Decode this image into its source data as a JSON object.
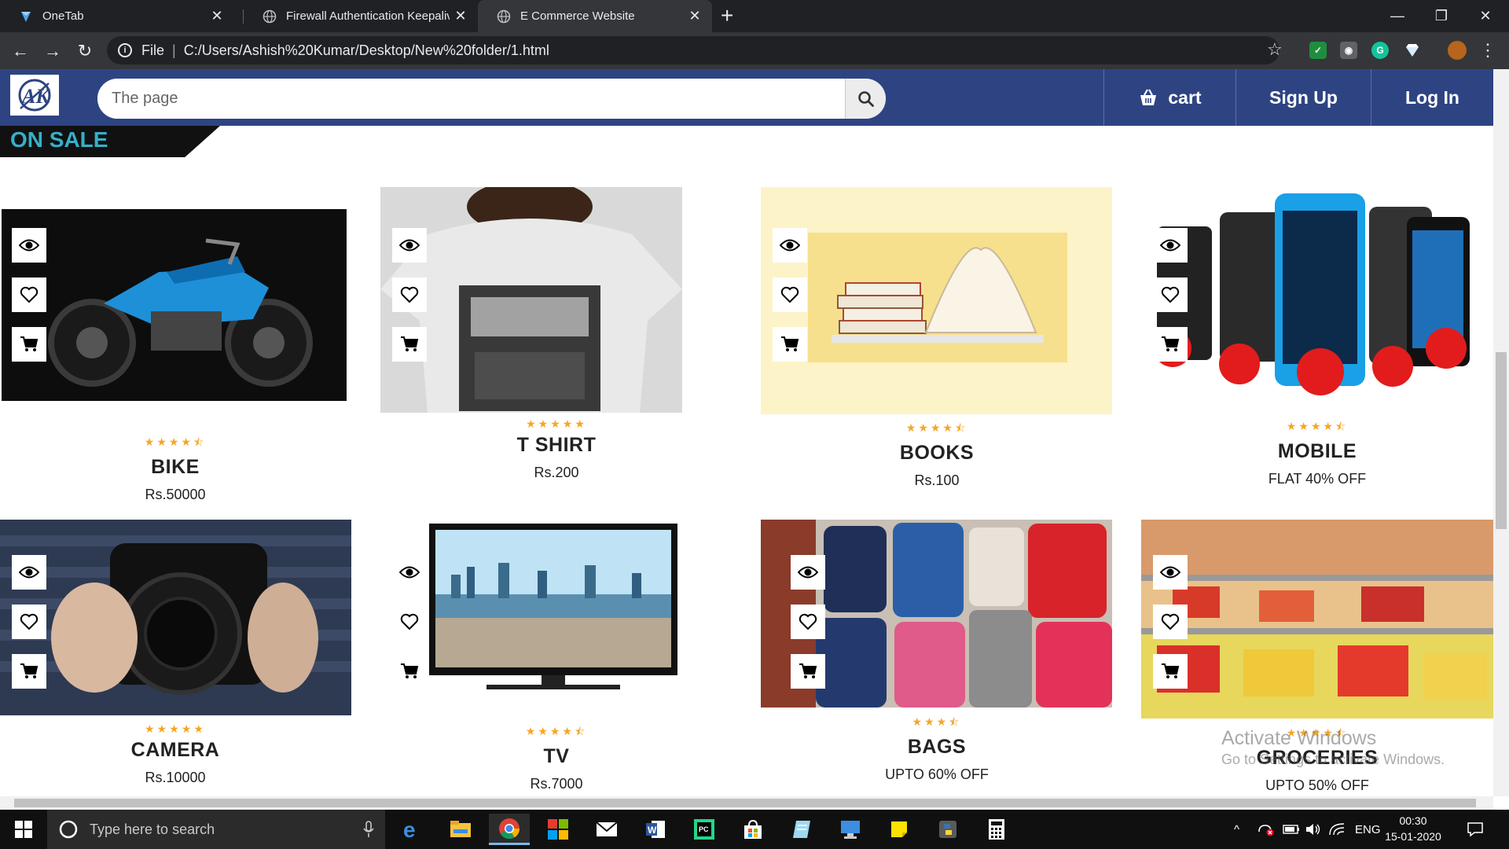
{
  "browser": {
    "tabs": [
      {
        "title": "OneTab",
        "icon": "onetab-icon",
        "active": false
      },
      {
        "title": "Firewall Authentication Keepalive",
        "icon": "globe-icon",
        "active": false
      },
      {
        "title": "E Commerce Website",
        "icon": "globe-icon",
        "active": true
      }
    ],
    "address": {
      "scheme_label": "File",
      "url": "C:/Users/Ashish%20Kumar/Desktop/New%20folder/1.html"
    }
  },
  "header": {
    "logo_text": "AK",
    "search_placeholder": "The page",
    "cart_label": "cart",
    "signup_label": "Sign Up",
    "login_label": "Log In",
    "bg_color": "#2e4482"
  },
  "banner": {
    "label": "ON SALE",
    "color": "#35b0c8"
  },
  "products": [
    {
      "name": "BIKE",
      "price": "Rs.50000",
      "stars": "★★★★⯪"
    },
    {
      "name": "T SHIRT",
      "price": "Rs.200",
      "stars": "★★★★★"
    },
    {
      "name": "BOOKS",
      "price": "Rs.100",
      "stars": "★★★★⯪"
    },
    {
      "name": "MOBILE",
      "price": "FLAT 40% OFF",
      "stars": "★★★★⯪"
    },
    {
      "name": "CAMERA",
      "price": "Rs.10000",
      "stars": "★★★★★"
    },
    {
      "name": "TV",
      "price": "Rs.7000",
      "stars": "★★★★⯪"
    },
    {
      "name": "BAGS",
      "price": "UPTO 60% OFF",
      "stars": "★★★⯪"
    },
    {
      "name": "GROCERIES",
      "price": "UPTO 50% OFF",
      "stars": "★★★★⯪"
    }
  ],
  "watermark": {
    "line1": "Activate Windows",
    "line2": "Go to Settings to activate Windows."
  },
  "taskbar": {
    "search_placeholder": "Type here to search",
    "language": "ENG",
    "time": "00:30",
    "date": "15-01-2020"
  }
}
